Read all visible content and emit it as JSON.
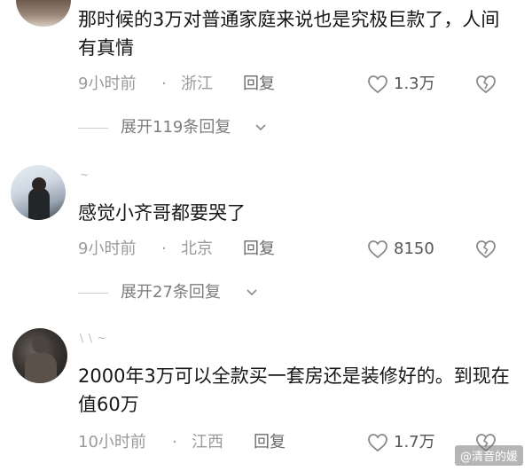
{
  "comments": [
    {
      "text": "那时候的3万对普通家庭来说也是究极巨款了，人间有真情",
      "time": "9小时前",
      "location": "浙江",
      "reply_label": "回复",
      "likes": "1.3万",
      "expand_label": "展开119条回复"
    },
    {
      "username": "~",
      "text": "感觉小齐哥都要哭了",
      "time": "9小时前",
      "location": "北京",
      "reply_label": "回复",
      "likes": "8150",
      "expand_label": "展开27条回复"
    },
    {
      "username": "\\ \\ ~",
      "text": "2000年3万可以全款买一套房还是装修好的。到现在值60万",
      "time": "10小时前",
      "location": "江西",
      "reply_label": "回复",
      "likes": "1.7万"
    }
  ],
  "separator": "·",
  "watermark": "@清音的媛",
  "colors": {
    "background": "#ffffff",
    "text": "#161616",
    "meta": "#9a9a9a"
  },
  "icons": {
    "like": "heart-outline-icon",
    "dislike": "broken-heart-icon",
    "expand": "chevron-down-icon"
  }
}
